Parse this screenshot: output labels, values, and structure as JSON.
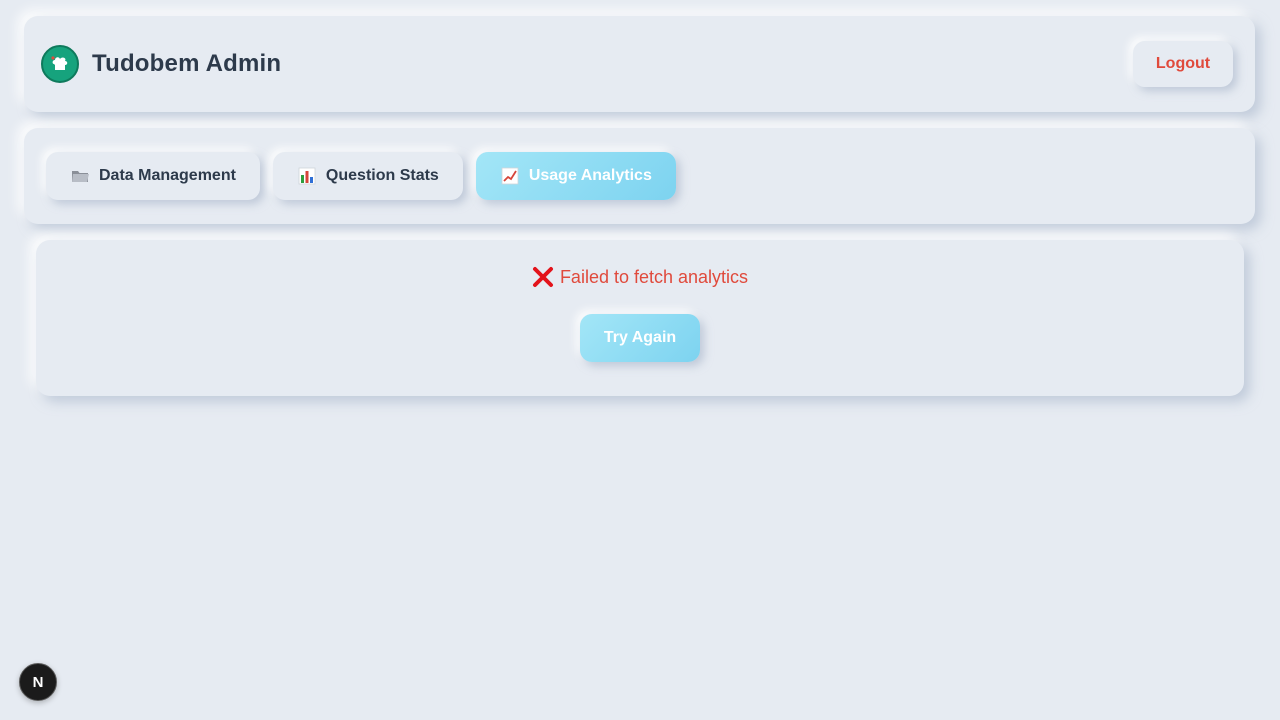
{
  "header": {
    "title": "Tudobem Admin",
    "logo_icon": "chef-hat-icon",
    "logout_label": "Logout",
    "logout_color": "#e04a3c"
  },
  "tabs": [
    {
      "label": "Data Management",
      "icon": "folder-icon",
      "active": false
    },
    {
      "label": "Question Stats",
      "icon": "bar-chart-icon",
      "active": false
    },
    {
      "label": "Usage Analytics",
      "icon": "chart-increasing-icon",
      "active": true
    }
  ],
  "error": {
    "icon": "cross-mark-icon",
    "message": "Failed to fetch analytics",
    "retry_label": "Try Again",
    "color": "#e04a3c"
  },
  "dev_badge": {
    "icon": "nextjs-icon",
    "label": "N"
  },
  "colors": {
    "background": "#e6ebf2",
    "accent": "#7dd3f0",
    "text": "#2d3a4b"
  }
}
